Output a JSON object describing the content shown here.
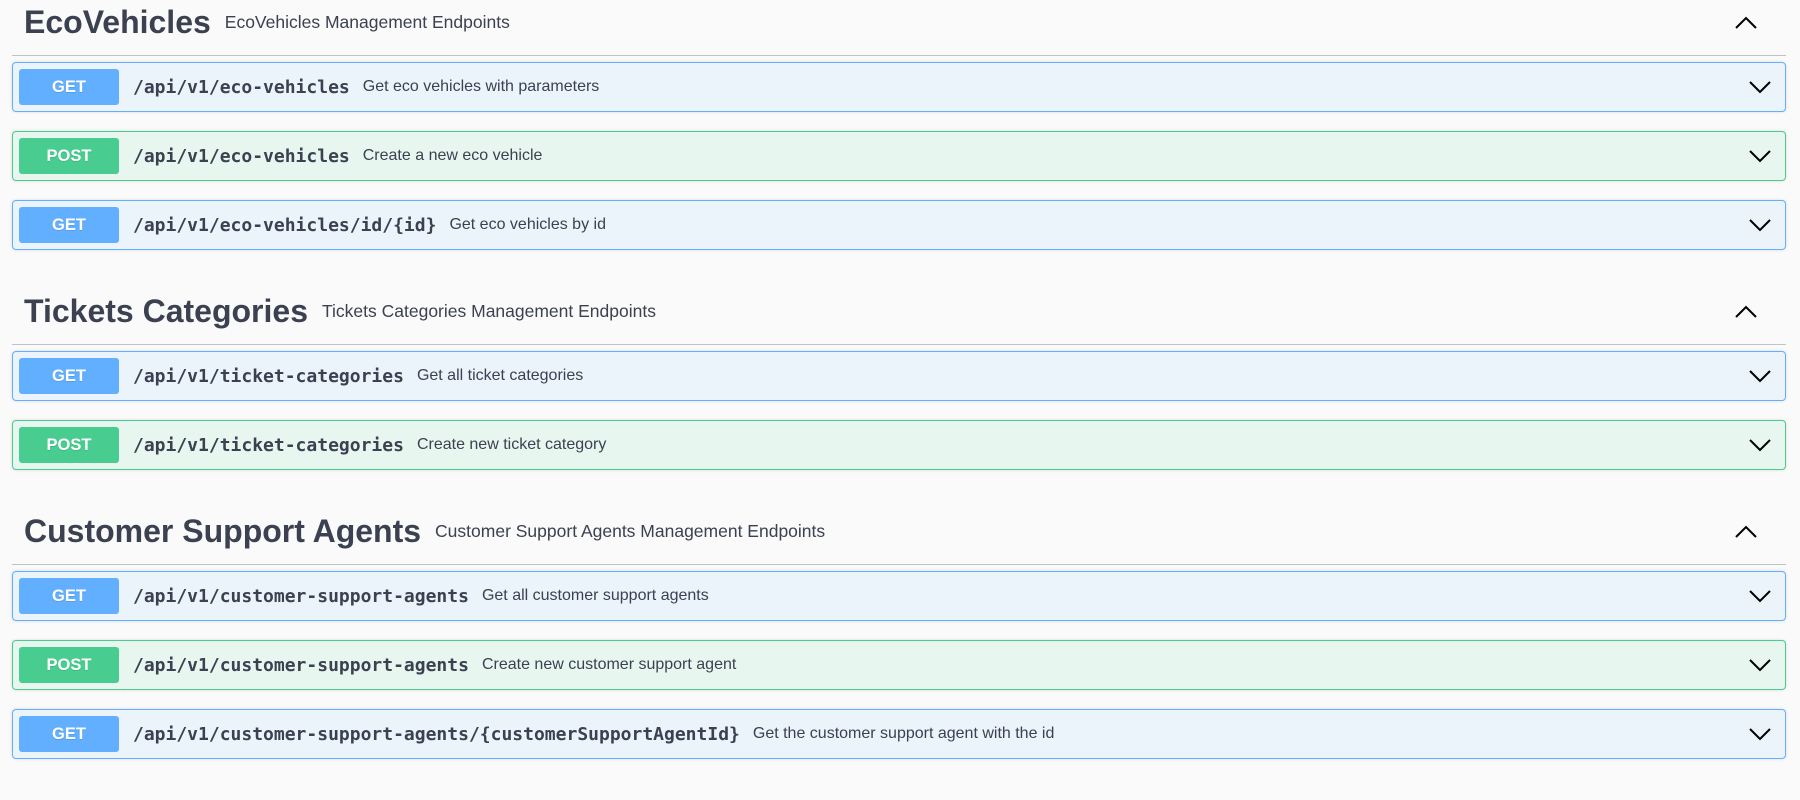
{
  "sections": [
    {
      "title": "EcoVehicles",
      "description": "EcoVehicles Management Endpoints",
      "operations": [
        {
          "method": "GET",
          "path": "/api/v1/eco-vehicles",
          "summary": "Get eco vehicles with parameters"
        },
        {
          "method": "POST",
          "path": "/api/v1/eco-vehicles",
          "summary": "Create a new eco vehicle"
        },
        {
          "method": "GET",
          "path": "/api/v1/eco-vehicles/id/{id}",
          "summary": "Get eco vehicles by id"
        }
      ]
    },
    {
      "title": "Tickets Categories",
      "description": "Tickets Categories Management Endpoints",
      "operations": [
        {
          "method": "GET",
          "path": "/api/v1/ticket-categories",
          "summary": "Get all ticket categories"
        },
        {
          "method": "POST",
          "path": "/api/v1/ticket-categories",
          "summary": "Create new ticket category"
        }
      ]
    },
    {
      "title": "Customer Support Agents",
      "description": "Customer Support Agents Management Endpoints",
      "operations": [
        {
          "method": "GET",
          "path": "/api/v1/customer-support-agents",
          "summary": "Get all customer support agents"
        },
        {
          "method": "POST",
          "path": "/api/v1/customer-support-agents",
          "summary": "Create new customer support agent"
        },
        {
          "method": "GET",
          "path": "/api/v1/customer-support-agents/{customerSupportAgentId}",
          "summary": "Get the customer support agent with the id"
        }
      ]
    }
  ],
  "icons": {
    "section_toggle": "chevron-up-icon",
    "operation_toggle": "chevron-down-icon"
  },
  "colors": {
    "get": "#61affe",
    "get_bg": "#ebf3fb",
    "post": "#49cc90",
    "post_bg": "#e8f6f0",
    "text": "#3b4151"
  }
}
